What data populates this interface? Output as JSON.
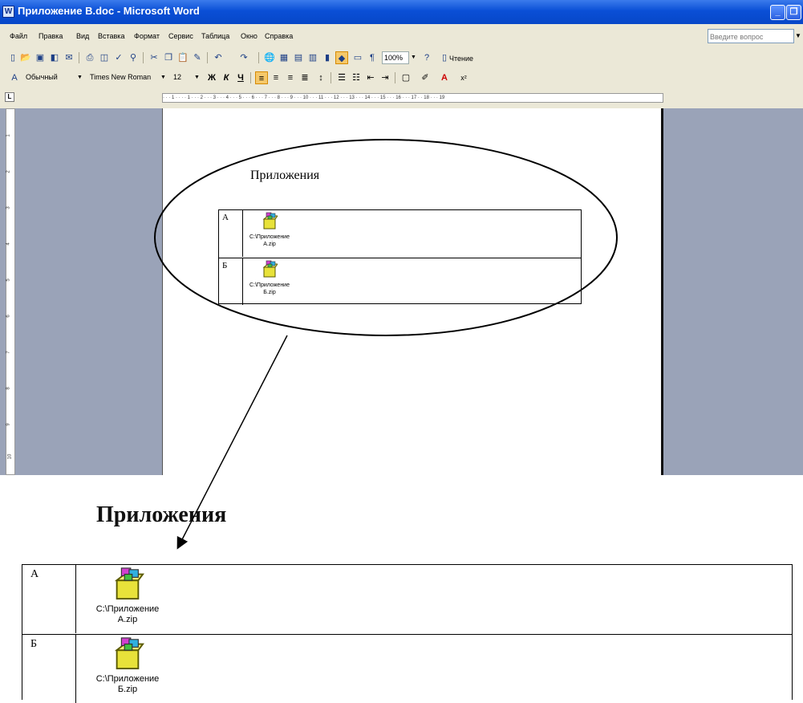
{
  "window": {
    "title": "Приложение В.doc - Microsoft Word",
    "min_symbol": "_",
    "max_symbol": "❐"
  },
  "menu": {
    "items": [
      "Файл",
      "Правка",
      "Вид",
      "Вставка",
      "Формат",
      "Сервис",
      "Таблица",
      "Окно",
      "Справка"
    ],
    "ask_placeholder": "Введите вопрос"
  },
  "toolbar": {
    "zoom": "100%",
    "reading_label": "Чтение"
  },
  "format": {
    "style": "Обычный",
    "font": "Times New Roman",
    "size": "12",
    "bold": "Ж",
    "italic": "К",
    "underline": "Ч"
  },
  "ruler": {
    "corner": "L",
    "marks": "· · · 1 · · · · 1 · · · 2 · · · 3 · · · 4 · · · 5 · · · 6 · · · 7 · · · 8 · · · 9 · · · 10 · · · 11 · · · 12 · · · 13 · · · 14 · · · 15 · · · 16 · · · 17 · · 18 · · · 19",
    "vertical": [
      "1",
      "2",
      "3",
      "4",
      "5",
      "6",
      "7",
      "8",
      "9",
      "10"
    ]
  },
  "document": {
    "heading": "Приложения",
    "rows": [
      {
        "label": "А",
        "icon": "package-icon",
        "caption_line1": "C:\\Приложение",
        "caption_line2": "A.zip"
      },
      {
        "label": "Б",
        "icon": "package-icon",
        "caption_line1": "C:\\Приложение",
        "caption_line2": "Б.zip"
      }
    ]
  },
  "zoomed": {
    "heading": "Приложения"
  },
  "colors": {
    "titlebar": "#0a4fd6",
    "toolbar_bg": "#ebe8d7",
    "workspace": "#9aa3b8"
  }
}
